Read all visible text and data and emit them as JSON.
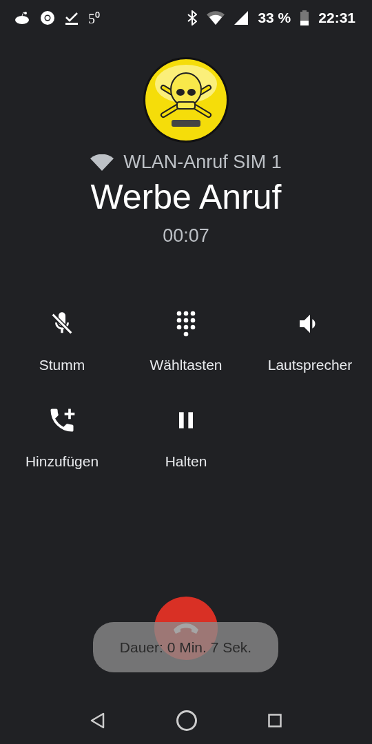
{
  "status_bar": {
    "notification_text": "5⁰",
    "battery": "33 %",
    "time": "22:31"
  },
  "call": {
    "line": "WLAN-Anruf SIM 1",
    "name": "Werbe Anruf",
    "timer": "00:07"
  },
  "controls": [
    {
      "kind": "mute",
      "label": "Stumm"
    },
    {
      "kind": "dialpad",
      "label": "Wähltasten"
    },
    {
      "kind": "speaker",
      "label": "Lautsprecher"
    },
    {
      "kind": "add-call",
      "label": "Hinzufügen"
    },
    {
      "kind": "hold",
      "label": "Halten"
    }
  ],
  "toast": "Dauer: 0 Min. 7 Sek."
}
